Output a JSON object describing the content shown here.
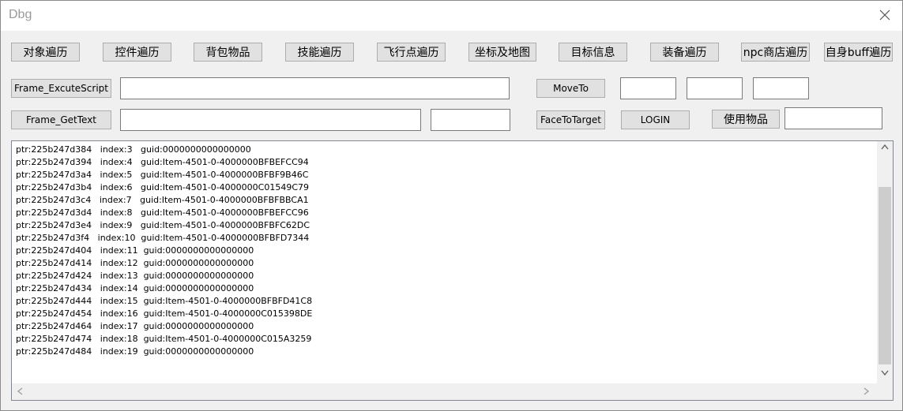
{
  "window": {
    "title": "Dbg"
  },
  "toolbar": {
    "buttons": [
      "对象遍历",
      "控件遍历",
      "背包物品",
      "技能遍历",
      "飞行点遍历",
      "坐标及地图",
      "目标信息",
      "装备遍历",
      "npc商店遍历",
      "自身buff遍历"
    ]
  },
  "row2": {
    "execute_script_label": "Frame_ExcuteScript",
    "script_value": "",
    "moveto_label": "MoveTo",
    "x_value": "",
    "y_value": "",
    "z_value": ""
  },
  "row3": {
    "gettext_label": "Frame_GetText",
    "gettext_value": "",
    "gettext_result": "",
    "facetotarget_label": "FaceToTarget",
    "login_label": "LOGIN",
    "useitem_label": "使用物品",
    "useitem_value": ""
  },
  "log": [
    "ptr:225b247d384   index:3   guid:0000000000000000",
    "ptr:225b247d394   index:4   guid:Item-4501-0-4000000BFBEFCC94",
    "ptr:225b247d3a4   index:5   guid:Item-4501-0-4000000BFBF9B46C",
    "ptr:225b247d3b4   index:6   guid:Item-4501-0-4000000C01549C79",
    "ptr:225b247d3c4   index:7   guid:Item-4501-0-4000000BFBFBBCA1",
    "ptr:225b247d3d4   index:8   guid:Item-4501-0-4000000BFBEFCC96",
    "ptr:225b247d3e4   index:9   guid:Item-4501-0-4000000BFBFC62DC",
    "ptr:225b247d3f4   index:10  guid:Item-4501-0-4000000BFBFD7344",
    "ptr:225b247d404   index:11  guid:0000000000000000",
    "ptr:225b247d414   index:12  guid:0000000000000000",
    "ptr:225b247d424   index:13  guid:0000000000000000",
    "ptr:225b247d434   index:14  guid:0000000000000000",
    "ptr:225b247d444   index:15  guid:Item-4501-0-4000000BFBFD41C8",
    "ptr:225b247d454   index:16  guid:Item-4501-0-4000000C015398DE",
    "ptr:225b247d464   index:17  guid:0000000000000000",
    "ptr:225b247d474   index:18  guid:Item-4501-0-4000000C015A3259",
    "ptr:225b247d484   index:19  guid:0000000000000000"
  ],
  "icons": {
    "close": "close-icon",
    "scroll_up": "chevron-up-icon",
    "scroll_down": "chevron-down-icon",
    "scroll_left": "chevron-left-icon",
    "scroll_right": "chevron-right-icon"
  }
}
